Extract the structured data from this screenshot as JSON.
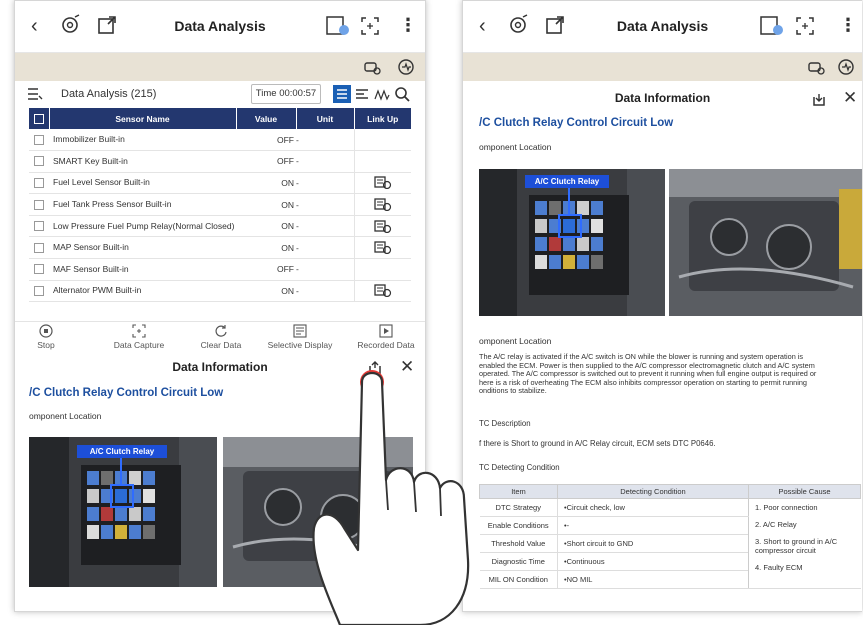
{
  "left": {
    "topbar": {
      "title": "Data Analysis"
    },
    "list_header": {
      "label": "Data Analysis (215)",
      "time": "Time 00:00:57"
    },
    "table": {
      "columns": [
        "Sensor Name",
        "Value",
        "Unit",
        "Link Up"
      ],
      "rows": [
        {
          "name": "Immobilizer Built-in",
          "value": "OFF",
          "unit": "-",
          "link": false
        },
        {
          "name": "SMART Key Built-in",
          "value": "OFF",
          "unit": "-",
          "link": false
        },
        {
          "name": "Fuel Level Sensor Built-in",
          "value": "ON",
          "unit": "-",
          "link": true
        },
        {
          "name": "Fuel Tank Press Sensor Built-in",
          "value": "ON",
          "unit": "-",
          "link": true
        },
        {
          "name": "Low Pressure Fuel Pump Relay(Normal Closed)",
          "value": "ON",
          "unit": "-",
          "link": true
        },
        {
          "name": "MAP Sensor Built-in",
          "value": "ON",
          "unit": "-",
          "link": true
        },
        {
          "name": "MAF Sensor Built-in",
          "value": "OFF",
          "unit": "-",
          "link": false
        },
        {
          "name": "Alternator PWM Built-in",
          "value": "ON",
          "unit": "-",
          "link": true
        }
      ]
    },
    "actions": [
      "Stop",
      "Data Capture",
      "Clear Data",
      "Selective Display",
      "Recorded Data"
    ],
    "panel": {
      "title": "Data Information",
      "dtc_title": "A/C Clutch Relay Control Circuit Low",
      "dtc_title_visible": "/C Clutch Relay Control Circuit Low",
      "component_location": "Component Location",
      "component_location_visible": "omponent Location",
      "relay_tag": "A/C Clutch Relay"
    }
  },
  "right": {
    "topbar": {
      "title": "Data Analysis"
    },
    "panel": {
      "title": "Data Information",
      "dtc_title_visible": "/C Clutch Relay Control Circuit Low",
      "component_location_visible": "omponent Location",
      "relay_tag": "A/C Clutch Relay",
      "component_location_2_visible": "omponent Location",
      "description": "The A/C relay is activated if the A/C switch is ON while the blower is running and system operation is enabled the ECM. Power is then supplied to the A/C compressor electromagnetic clutch and A/C system operated. The A/C compressor is switched out to prevent it running when full engine output is required or here is a risk of overheating The ECM also inhibits compressor operation on starting to permit running onditions to stabilize.",
      "desc_lines": [
        "The A/C relay is activated if the A/C switch is ON while the blower is running and system operation is",
        "enabled the ECM. Power is then supplied to the A/C compressor electromagnetic clutch and A/C system",
        "operated. The A/C compressor is switched out to prevent it running when full engine output is required or",
        "here is a risk of overheating The ECM also inhibits compressor operation on starting to permit running",
        "onditions to stabilize."
      ],
      "dtc_description_label": "TC Description",
      "dtc_description_text": "f there is Short to ground in A/C Relay circuit, ECM sets DTC P0646.",
      "dtc_detecting_label": "TC Detecting Condition",
      "detect_table": {
        "headers": [
          "Item",
          "Detecting Condition",
          "Possible Cause"
        ],
        "rows": [
          {
            "item": "DTC Strategy",
            "cond": "•Circuit check, low"
          },
          {
            "item": "Enable Conditions",
            "cond": "•-"
          },
          {
            "item": "Threshold Value",
            "cond": "•Short circuit to GND"
          },
          {
            "item": "Diagnostic Time",
            "cond": "•Continuous"
          },
          {
            "item": "MIL ON Condition",
            "cond": "•NO MIL"
          }
        ],
        "causes": [
          "1. Poor connection",
          "2. A/C Relay",
          "3. Short to ground in A/C compressor circuit",
          "4. Faulty ECM"
        ]
      }
    }
  }
}
